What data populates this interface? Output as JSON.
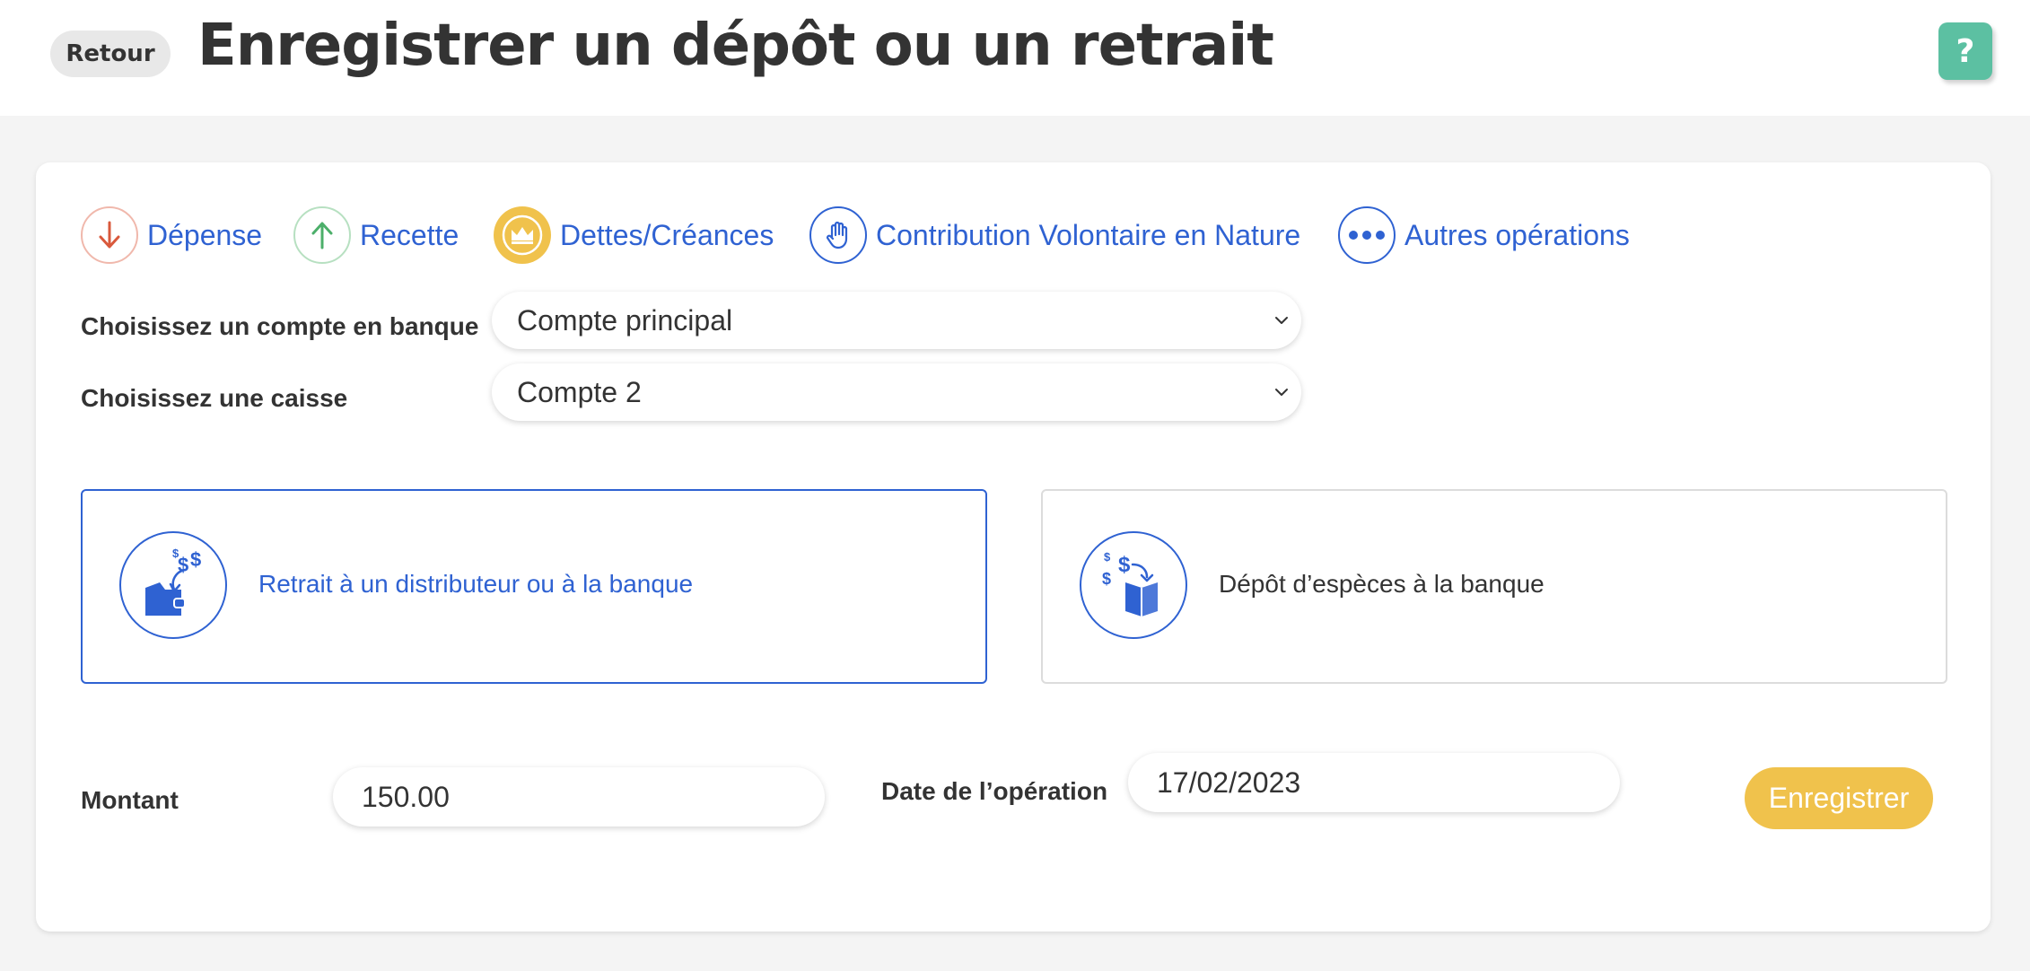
{
  "header": {
    "back_label": "Retour",
    "title": "Enregistrer un dépôt ou un retrait",
    "help_label": "?"
  },
  "operation_types": [
    {
      "label": "Dépense",
      "icon": "arrow-down-icon",
      "color": "#d9593c"
    },
    {
      "label": "Recette",
      "icon": "arrow-up-icon",
      "color": "#4caf6a"
    },
    {
      "label": "Dettes/Créances",
      "icon": "crown-icon",
      "color": "#f0c24c"
    },
    {
      "label": "Contribution Volontaire en Nature",
      "icon": "hand-icon",
      "color": "#2f62d2"
    },
    {
      "label": "Autres opérations",
      "icon": "dots-icon",
      "color": "#2f62d2"
    }
  ],
  "form": {
    "bank_label": "Choisissez un compte en banque",
    "bank_value": "Compte principal",
    "cash_label": "Choisissez une caisse",
    "cash_value": "Compte 2",
    "amount_label": "Montant",
    "amount_value": "150.00",
    "date_label": "Date de l’opération",
    "date_value": "17/02/2023",
    "save_label": "Enregistrer"
  },
  "operations": {
    "withdrawal_label": "Retrait à un distributeur ou à la banque",
    "deposit_label": "Dépôt d’espèces à la banque",
    "selected": "withdrawal"
  },
  "colors": {
    "accent": "#2f62d2",
    "help": "#5cc0a2",
    "save": "#f0c24c"
  }
}
